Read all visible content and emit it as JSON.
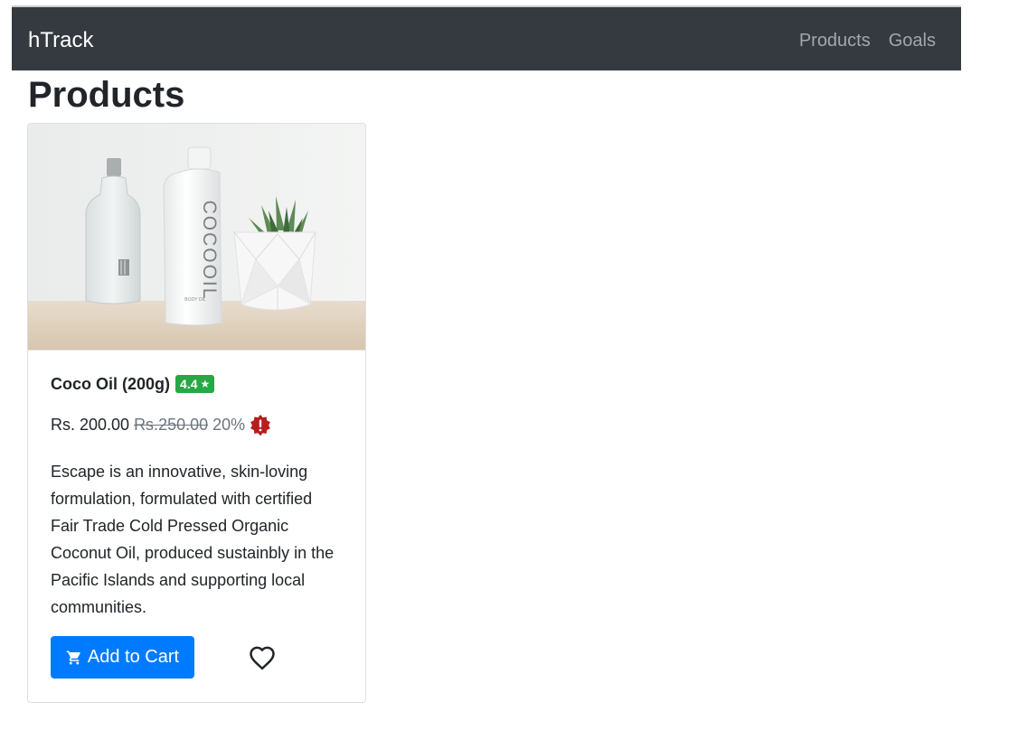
{
  "navbar": {
    "brand": "hTrack",
    "links": [
      "Products",
      "Goals"
    ]
  },
  "page": {
    "title": "Products"
  },
  "product": {
    "name": "Coco Oil (200g)",
    "rating": "4.4",
    "rating_icon": "star-icon",
    "price": "Rs. 200.00",
    "original_price": "Rs.250.00",
    "discount": "20%",
    "discount_icon": "alert-badge-icon",
    "description": "Escape is an innovative, skin-loving formulation, formulated with certified Fair Trade Cold Pressed Organic Coconut Oil, produced sustainbly in the Pacific Islands and supporting local communities.",
    "image": {
      "bottle_label": "COCOOIL",
      "bottle_sub": "BODY OIL"
    },
    "add_to_cart_label": "Add to Cart",
    "cart_icon": "cart-icon",
    "wishlist_icon": "heart-icon"
  },
  "colors": {
    "navbar_bg": "#343a40",
    "primary": "#007bff",
    "rating_badge": "#28a745",
    "discount_badge": "#b71c1c"
  }
}
